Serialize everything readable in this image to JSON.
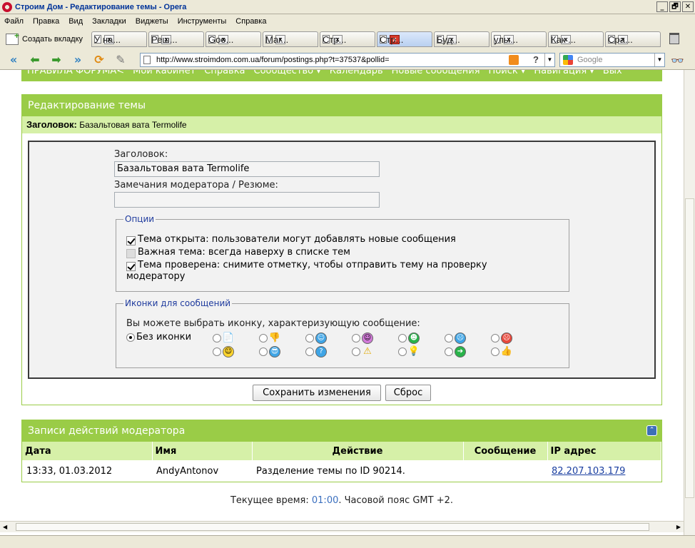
{
  "window": {
    "title": "Строим Дом - Редактирование темы - Opera",
    "buttons": [
      "_",
      "🗗",
      "✕"
    ]
  },
  "menu": [
    "Файл",
    "Правка",
    "Вид",
    "Закладки",
    "Виджеты",
    "Инструменты",
    "Справка"
  ],
  "tabs": {
    "new_tab_label": "Создать вкладку",
    "items": [
      "У на...",
      "Реш...",
      "Goo...",
      "Маг...",
      "Стр...",
      "Стр...",
      "Буд...",
      "улы...",
      "Как ...",
      "Сра..."
    ],
    "active_index": 5
  },
  "nav": {
    "url": "http://www.stroimdom.com.ua/forum/postings.php?t=37537&pollid=",
    "search_placeholder": "Google"
  },
  "forum_nav": [
    "ПРАВИЛА ФОРУМА<",
    "Мой кабинет",
    "Справка",
    "Сообщество ▾",
    "Календарь",
    "Новые сообщения",
    "Поиск ▾",
    "Навигация ▾",
    "Вых"
  ],
  "edit": {
    "header": "Редактирование темы",
    "subheader_label": "Заголовок:",
    "subheader_value": "Базальтовая вата Termolife",
    "title_label": "Заголовок:",
    "title_value": "Базальтовая вата Termolife",
    "notes_label": "Замечания модератора / Резюме:",
    "notes_value": "",
    "options": {
      "legend": "Опции",
      "open_label": "Тема открыта: пользователи могут добавлять новые сообщения",
      "open_checked": true,
      "sticky_label": "Важная тема: всегда наверху в списке тем",
      "sticky_checked": false,
      "moderated_label_1": "Тема проверена: снимите отметку, чтобы отправить тему на проверку",
      "moderated_label_2": "модератору",
      "moderated_checked": true
    },
    "icons": {
      "legend": "Иконки для сообщений",
      "prompt": "Вы можете выбрать иконку, характеризующую сообщение:",
      "none_label": "Без иконки",
      "selected": "none"
    },
    "save_button": "Сохранить изменения",
    "reset_button": "Сброс"
  },
  "modlog": {
    "header": "Записи действий модератора",
    "columns": [
      "Дата",
      "Имя",
      "Действие",
      "Сообщение",
      "IP адрес"
    ],
    "rows": [
      {
        "date": "13:33, 01.03.2012",
        "name": "AndyAntonov",
        "action": "Разделение темы по ID 90214.",
        "message": "",
        "ip": "82.207.103.179"
      }
    ]
  },
  "footer": {
    "prefix": "Текущее время:",
    "time": "01:00",
    "suffix": ". Часовой пояс GMT +2."
  }
}
